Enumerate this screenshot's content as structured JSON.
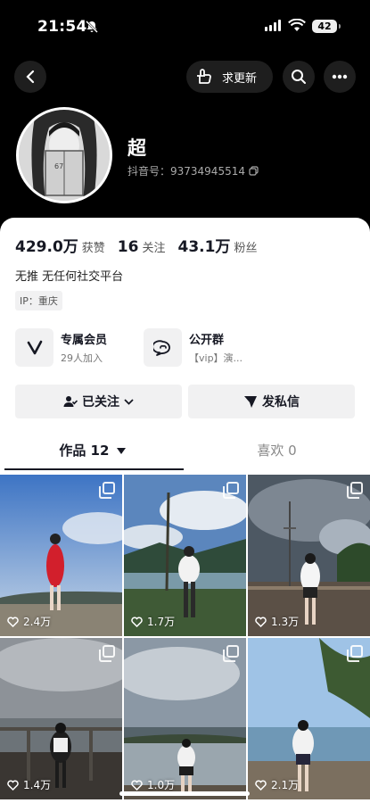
{
  "status_bar": {
    "time": "21:54",
    "battery": "42"
  },
  "nav": {
    "update_label": "求更新"
  },
  "profile": {
    "nickname": "超",
    "douyin_id": "抖音号：93734945514"
  },
  "stats": [
    {
      "value": "429.0万",
      "label": "获赞"
    },
    {
      "value": "16",
      "label": "关注"
    },
    {
      "value": "43.1万",
      "label": "粉丝"
    }
  ],
  "bio": "无推 无任何社交平台",
  "ip": "IP：重庆",
  "features": [
    {
      "title": "专属会员",
      "subtitle": "29人加入"
    },
    {
      "title": "公开群",
      "subtitle": "【vip】演..."
    }
  ],
  "actions": {
    "follow": "已关注",
    "message": "发私信"
  },
  "tabs": {
    "works": "作品 12",
    "likes": "喜欢 0"
  },
  "posts": [
    {
      "likes": "2.4万"
    },
    {
      "likes": "1.7万"
    },
    {
      "likes": "1.3万"
    },
    {
      "likes": "1.4万"
    },
    {
      "likes": "1.0万"
    },
    {
      "likes": "2.1万"
    }
  ],
  "colors": {
    "background": "#000000",
    "card": "#ffffff",
    "text_dark": "#161823"
  }
}
